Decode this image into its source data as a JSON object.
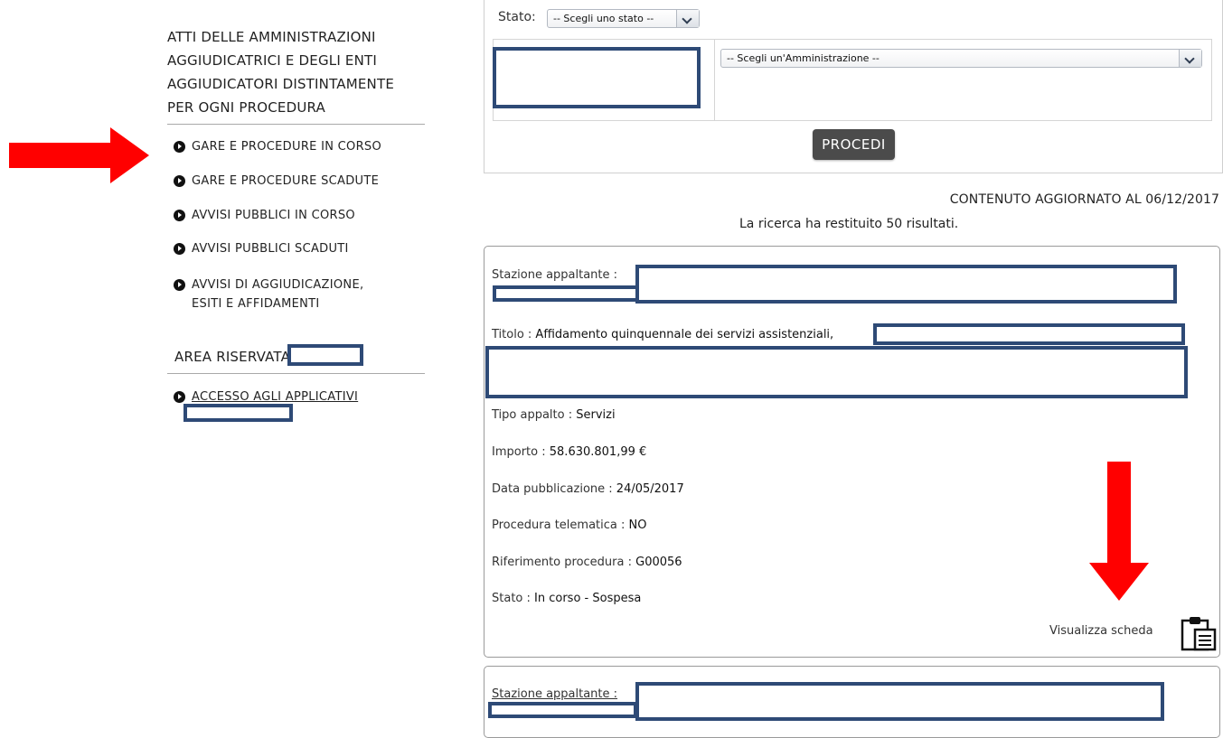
{
  "sidebar": {
    "title_lines": [
      "ATTI DELLE AMMINISTRAZIONI",
      "AGGIUDICATRICI E DEGLI ENTI",
      "AGGIUDICATORI DISTINTAMENTE",
      "PER OGNI PROCEDURA"
    ],
    "items": [
      {
        "label": "GARE E PROCEDURE IN CORSO"
      },
      {
        "label": "GARE E PROCEDURE SCADUTE"
      },
      {
        "label": "AVVISI PUBBLICI IN CORSO"
      },
      {
        "label": "AVVISI PUBBLICI SCADUTI"
      },
      {
        "label_line1": "AVVISI DI AGGIUDICAZIONE,",
        "label_line2": "ESITI E AFFIDAMENTI"
      }
    ],
    "area_title": "AREA RISERVATA",
    "area_item": "ACCESSO AGLI APPLICATIVI"
  },
  "filters": {
    "stato_label": "Stato:",
    "stato_value": "-- Scegli uno stato --",
    "amministrazione_value": "-- Scegli un'Amministrazione --",
    "procedi_label": "PROCEDI"
  },
  "updated_text": "CONTENUTO AGGIORNATO AL 06/12/2017",
  "results_text": "La ricerca ha restituito 50 risultati.",
  "card1": {
    "stazione_label": "Stazione appaltante :",
    "titolo_label": "Titolo :",
    "titolo_value": "Affidamento quinquennale dei servizi assistenziali,",
    "tipo_label": "Tipo appalto :",
    "tipo_value": "Servizi",
    "importo_label": "Importo :",
    "importo_value": "58.630.801,99 €",
    "data_label": "Data pubblicazione :",
    "data_value": "24/05/2017",
    "telematica_label": "Procedura telematica :",
    "telematica_value": "NO",
    "riferimento_label": "Riferimento procedura :",
    "riferimento_value": "G00056",
    "stato_label": "Stato :",
    "stato_value": "In corso - Sospesa",
    "visualizza_label": "Visualizza scheda"
  },
  "card2": {
    "stazione_label": "Stazione appaltante :"
  },
  "colors": {
    "arrow": "#ff0000",
    "redaction_border": "#2e4a76",
    "button_bg": "#4b4b4b"
  }
}
